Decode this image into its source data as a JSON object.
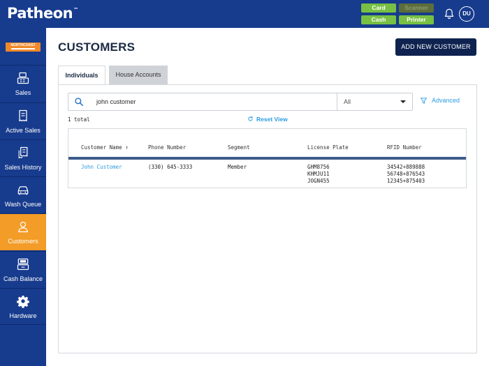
{
  "app": {
    "logo": "Patheon",
    "trademark": "™",
    "device_buttons": [
      {
        "label": "Card"
      },
      {
        "label": "Scanner"
      },
      {
        "label": "Cash"
      },
      {
        "label": "Printer"
      }
    ],
    "user_initials": "DU"
  },
  "sidebar": {
    "brand_badge": "NORTHCOAST",
    "items": [
      {
        "label": "Sales",
        "icon": "register-icon"
      },
      {
        "label": "Active Sales",
        "icon": "receipt-icon"
      },
      {
        "label": "Sales History",
        "icon": "receipt-history-icon"
      },
      {
        "label": "Wash Queue",
        "icon": "car-icon"
      },
      {
        "label": "Customers",
        "icon": "customer-icon"
      },
      {
        "label": "Cash Balance",
        "icon": "cash-register-icon"
      },
      {
        "label": "Hardware",
        "icon": "gear-icon"
      }
    ]
  },
  "page": {
    "title": "CUSTOMERS",
    "add_button": "ADD NEW CUSTOMER",
    "tabs": [
      {
        "label": "Individuals",
        "active": true
      },
      {
        "label": "House Accounts",
        "active": false
      }
    ],
    "search": {
      "value": "john customer",
      "filter_value": "All"
    },
    "advanced_label": "Advanced",
    "total_text": "1 total",
    "reset_label": "Reset View"
  },
  "table": {
    "columns": [
      "Customer Name ↑",
      "Phone Number",
      "Segment",
      "License Plate",
      "RFID Number"
    ],
    "rows": [
      {
        "name": "John Customer",
        "phone": "(330) 645-3333",
        "segment": "Member",
        "plates": [
          "GHM8756",
          "KHMJU11",
          "JOGN455"
        ],
        "rfids": [
          "34542+889888",
          "56748+876543",
          "12345+875403"
        ]
      }
    ]
  },
  "colors": {
    "primary_navy": "#173b8d",
    "accent_orange": "#f39c27",
    "status_green": "#77c043",
    "link_blue": "#2b9be0"
  }
}
